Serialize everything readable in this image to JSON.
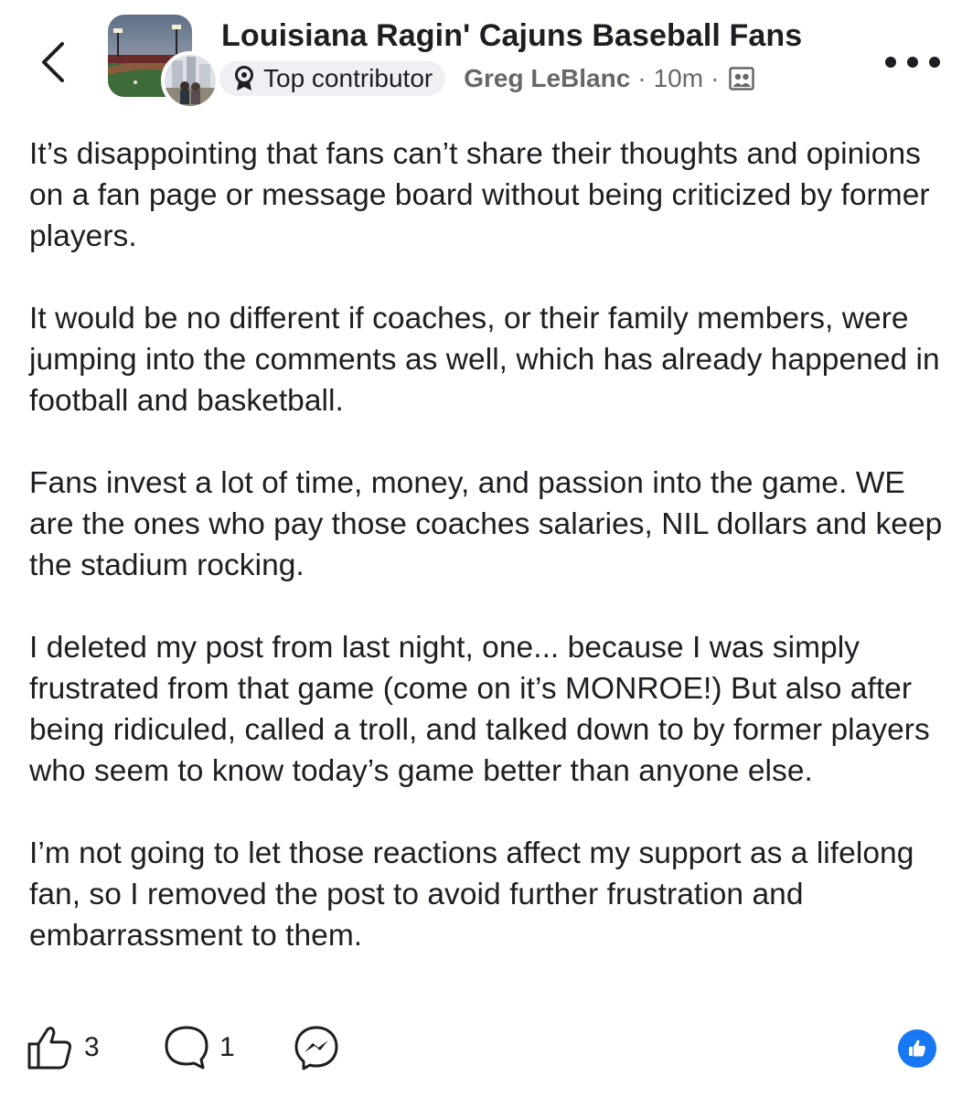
{
  "header": {
    "back_icon": "chevron-left-icon",
    "group_name": "Louisiana Ragin' Cajuns Baseball Fans",
    "badge_label": "Top contributor",
    "badge_icon": "medal-icon",
    "author": "Greg LeBlanc",
    "separator": "·",
    "time": "10m",
    "audience_icon": "group-members-icon",
    "more_icon": "more-dots-icon"
  },
  "post": {
    "paragraphs": [
      "It’s disappointing that fans can’t share their thoughts and opinions on a fan page or message board without being criticized by former players.",
      "It would be no different if coaches, or their family members, were jumping into the comments as well, which has already happened in football and basketball.",
      "Fans invest a lot of time, money, and passion into the game. WE are the ones who pay those coaches salaries, NIL dollars and keep the stadium rocking.",
      "I deleted my post from last night, one... because I was simply frustrated from that game (come on it’s MONROE!) But also after being ridiculed, called a troll, and talked down to by former players who seem to know today’s game better than anyone else.",
      "I’m not going to let those reactions affect my support as a lifelong fan, so I removed the post to avoid further frustration and embarrassment to them."
    ]
  },
  "actions": {
    "like_count": "3",
    "comment_count": "1",
    "like_icon": "thumbs-up-icon",
    "comment_icon": "comment-icon",
    "share_icon": "messenger-icon",
    "reaction_icon": "like-reaction-icon"
  },
  "colors": {
    "text": "#1c1e21",
    "secondary": "#65676b",
    "badge_bg": "#eef0f3",
    "reaction_blue": "#1877f2"
  }
}
